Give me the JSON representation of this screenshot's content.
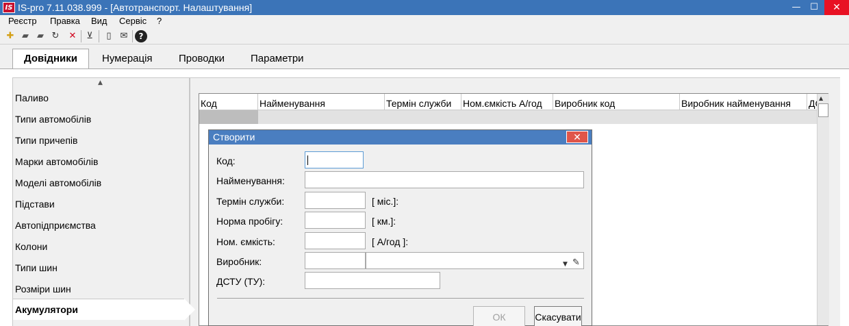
{
  "window": {
    "logo": "IS",
    "title": "IS-pro 7.11.038.999 - [Автотранспорт. Налаштування]",
    "min_glyph": "—",
    "max_glyph": "☐",
    "close_glyph": "✕"
  },
  "menu": [
    "Реєстр",
    "Правка",
    "Вид",
    "Сервіс",
    "?"
  ],
  "toolbar": {
    "icons": [
      "new-icon",
      "edit-icon",
      "copy-icon",
      "refresh-icon",
      "delete-icon",
      "clear-filter-icon",
      "document-icon",
      "mail-icon",
      "help-icon"
    ],
    "glyphs": [
      "✚",
      "▰",
      "▰",
      "↻",
      "✕",
      "⊻",
      "▯",
      "✉",
      "?"
    ]
  },
  "tabs": {
    "t0": "Довідники",
    "t1": "Нумерація",
    "t2": "Проводки",
    "t3": "Параметри"
  },
  "sidebar": {
    "scroll_up": "▲",
    "items": [
      "Паливо",
      "Типи автомобілів",
      "Типи причепів",
      "Марки автомобілів",
      "Моделі автомобілів",
      "Підстави",
      "Автопідприємства",
      "Колони",
      "Типи шин",
      "Розміри шин",
      "Акумулятори"
    ],
    "selected_index": 10
  },
  "grid": {
    "columns": [
      "Код",
      "Найменування",
      "Термін служби",
      "Ном.ємкість А/год",
      "Виробник код",
      "Виробник найменування",
      "ДС"
    ],
    "scroll_up": "▲"
  },
  "dialog": {
    "title": "Створити",
    "close_glyph": "✕",
    "fields": {
      "code_label": "Код:",
      "name_label": "Найменування:",
      "service_label": "Термін служби:",
      "mileage_label": "Норма пробігу:",
      "capacity_label": "Ном. ємкість:",
      "maker_label": "Виробник:",
      "dstu_label": "ДСТУ (ТУ):"
    },
    "units": {
      "service": "[ міс.]:",
      "mileage": "[ км.]:",
      "capacity": "[ А/год ]:"
    },
    "combo_arrow": "▼",
    "combo_pencil": "✎",
    "ok_label": "ОК",
    "cancel_label": "Скасувати"
  }
}
